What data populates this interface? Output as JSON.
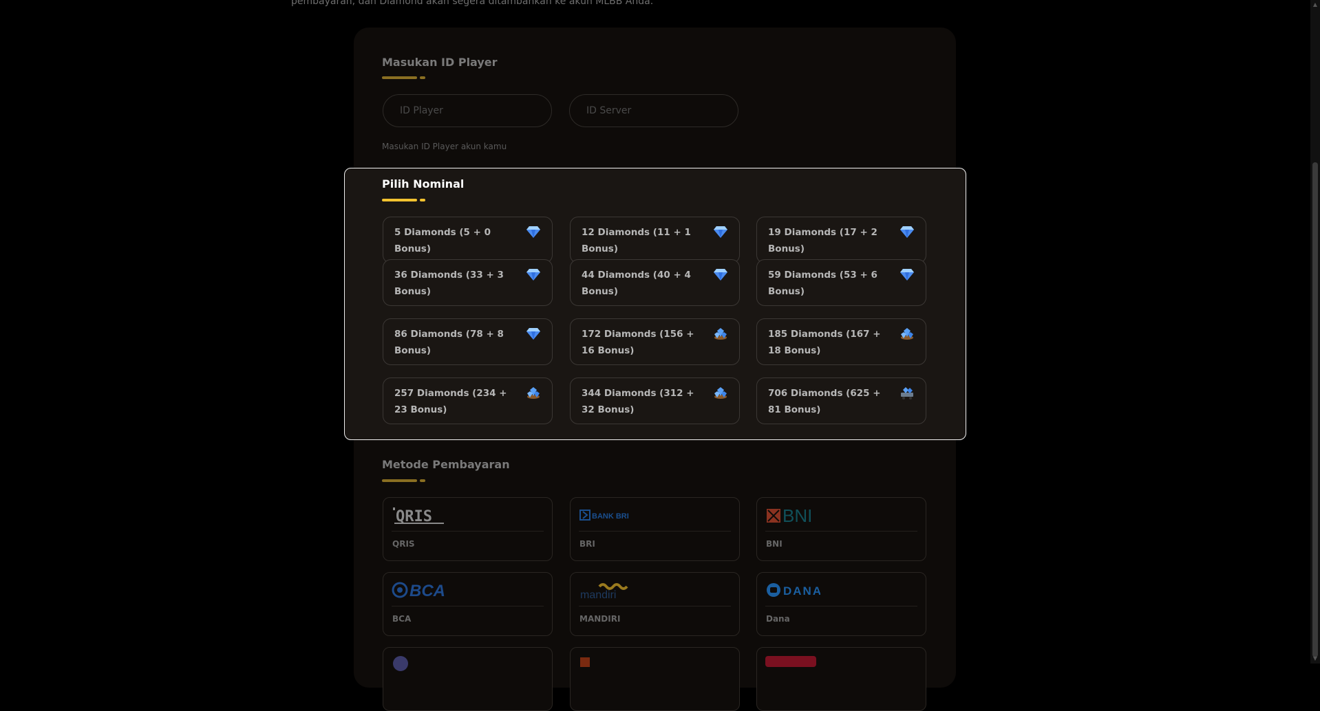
{
  "intro": {
    "text": "pembayaran, dan Diamond akan segera ditambahkan ke akun MLBB Anda."
  },
  "player_section": {
    "title": "Masukan ID Player",
    "player_id_placeholder": "ID Player",
    "server_id_placeholder": "ID Server",
    "hint": "Masukan ID Player akun kamu"
  },
  "nominal_section": {
    "title": "Pilih Nominal",
    "items": [
      {
        "label": "5 Diamonds (5 + 0 Bonus)",
        "icon": "diamond-icon"
      },
      {
        "label": "12 Diamonds (11 + 1 Bonus)",
        "icon": "diamond-icon"
      },
      {
        "label": "19 Diamonds (17 + 2 Bonus)",
        "icon": "diamond-icon"
      },
      {
        "label": "36 Diamonds (33 + 3 Bonus)",
        "icon": "diamond-icon"
      },
      {
        "label": "44 Diamonds (40 + 4 Bonus)",
        "icon": "diamond-icon"
      },
      {
        "label": "59 Diamonds (53 + 6 Bonus)",
        "icon": "diamond-icon"
      },
      {
        "label": "86 Diamonds (78 + 8 Bonus)",
        "icon": "diamond-icon"
      },
      {
        "label": "172 Diamonds (156 + 16 Bonus)",
        "icon": "diamond-pile-icon"
      },
      {
        "label": "185 Diamonds (167 + 18 Bonus)",
        "icon": "diamond-pile-icon"
      },
      {
        "label": "257 Diamonds (234 + 23 Bonus)",
        "icon": "diamond-pile-icon"
      },
      {
        "label": "344 Diamonds (312 + 32 Bonus)",
        "icon": "diamond-pile-icon"
      },
      {
        "label": "706 Diamonds (625 + 81 Bonus)",
        "icon": "diamond-cart-icon"
      }
    ]
  },
  "payment_section": {
    "title": "Metode Pembayaran",
    "methods": [
      {
        "name": "QRIS",
        "logo": "QRIS"
      },
      {
        "name": "BRI",
        "logo": "BANK BRI"
      },
      {
        "name": "BNI",
        "logo": "BNI"
      },
      {
        "name": "BCA",
        "logo": "BCA"
      },
      {
        "name": "MANDIRI",
        "logo": "mandiri"
      },
      {
        "name": "Dana",
        "logo": "DANA"
      }
    ]
  },
  "colors": {
    "accent": "#f2c230",
    "accent_muted": "#8a6f22",
    "background": "#000000",
    "card": "#0e0b09"
  }
}
